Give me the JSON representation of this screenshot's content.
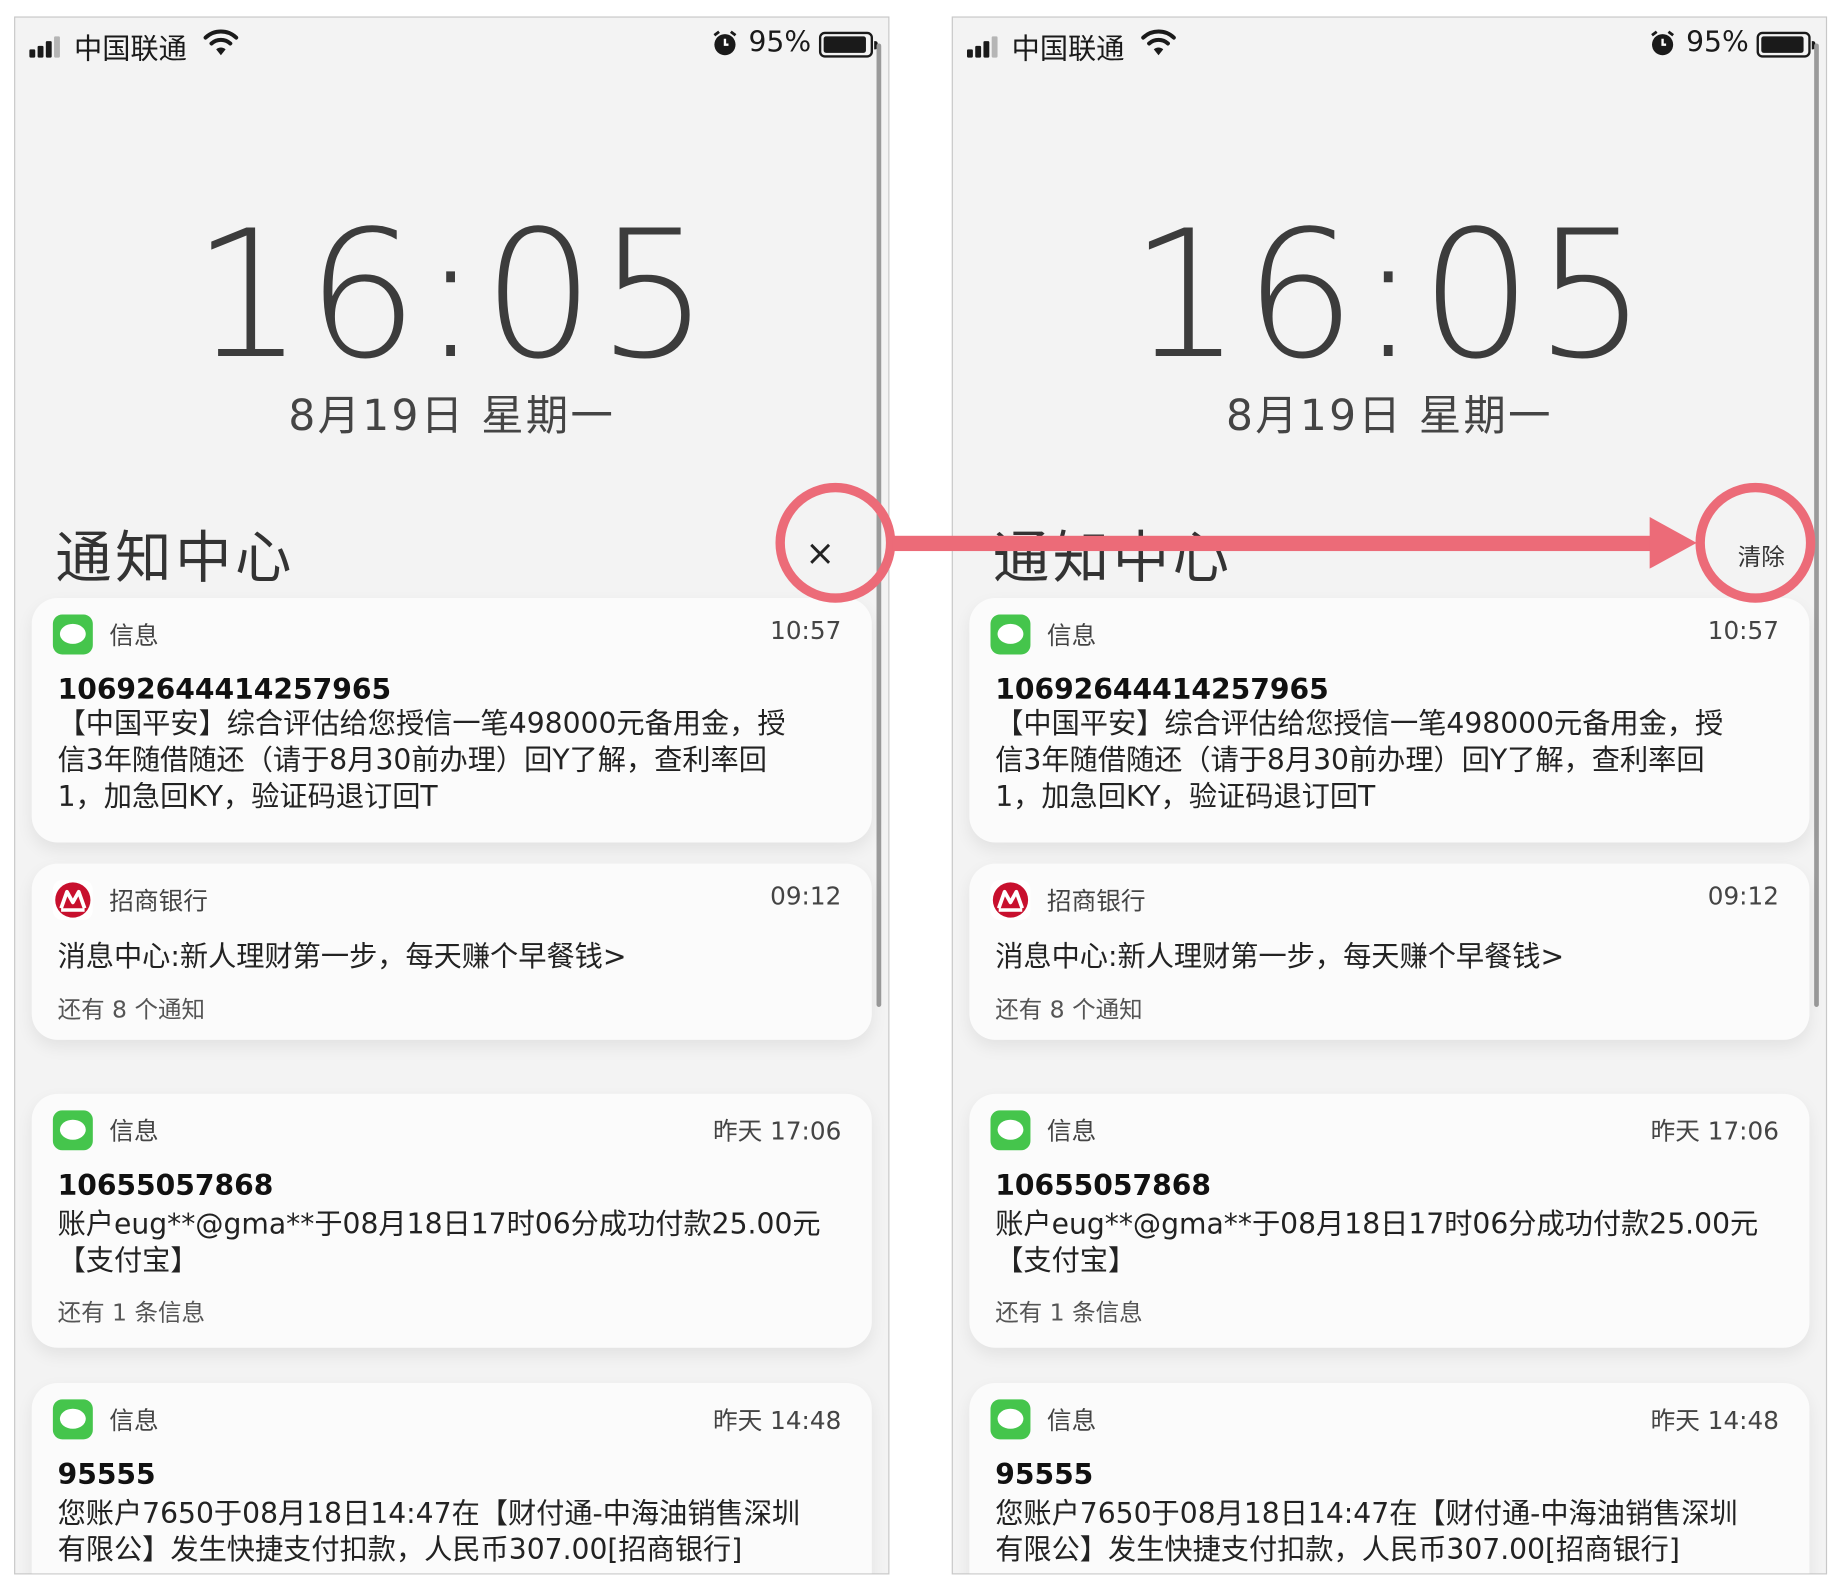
{
  "status_bar": {
    "carrier": "中国联通",
    "battery": "95%"
  },
  "lock_screen": {
    "time": "16:05",
    "date": "8月19日 星期一"
  },
  "notification_center": {
    "title": "通知中心",
    "clear_x": "×",
    "clear_label": "清除"
  },
  "notifications": [
    {
      "app": "信息",
      "time": "10:57",
      "title": "10692644414257965",
      "lines": [
        "【中国平安】综合评估给您授信一笔498000元备用金，授",
        "信3年随借随还（请于8月30前办理）回Y了解，查利率回",
        "1，加急回KY，验证码退订回T"
      ]
    },
    {
      "app": "招商银行",
      "time": "09:12",
      "lines": [
        "消息中心:新人理财第一步，每天赚个早餐钱>"
      ],
      "more": "还有 8 个通知"
    },
    {
      "app": "信息",
      "time": "昨天 17:06",
      "title": "10655057868",
      "lines": [
        "账户eug**@gma**于08月18日17时06分成功付款25.00元",
        "【支付宝】"
      ],
      "more": "还有 1 条信息"
    },
    {
      "app": "信息",
      "time": "昨天 14:48",
      "title": "95555",
      "lines": [
        "您账户7650于08月18日14:47在【财付通-中海油销售深圳",
        "有限公】发生快捷支付扣款，人民币307.00[招商银行]"
      ]
    }
  ],
  "colors": {
    "annotation": "#ec6b78",
    "messages_green": "#45c54c",
    "cmb_red": "#c8102e"
  },
  "icons": [
    "signal-icon",
    "wifi-icon",
    "alarm-icon",
    "battery-icon",
    "messages-icon",
    "cmb-logo-icon"
  ]
}
